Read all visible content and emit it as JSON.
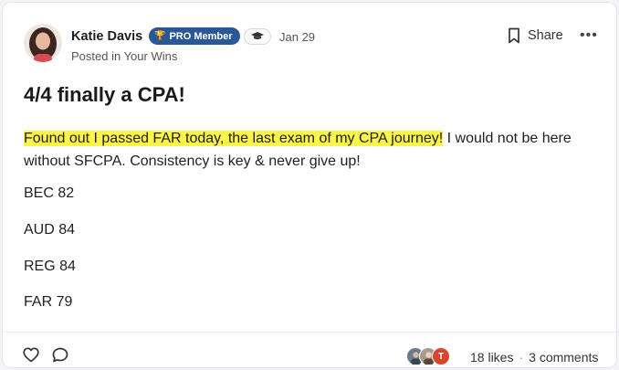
{
  "post": {
    "author": "Katie Davis",
    "badge": "PRO Member",
    "date": "Jan 29",
    "category": "Posted in Your Wins",
    "title": "4/4 finally a CPA!",
    "highlighted_text": "Found out I passed FAR today, the last exam of my CPA journey!",
    "body_rest": " I would not be here without SFCPA. Consistency is key & never give up!",
    "scores": [
      "BEC 82",
      "AUD 84",
      "REG 84",
      "FAR 79"
    ]
  },
  "actions": {
    "share_label": "Share"
  },
  "footer": {
    "likes": "18 likes",
    "separator": "·",
    "comments": "3 comments",
    "liker_initial": "T"
  },
  "colors": {
    "badge_bg": "#2b5797",
    "highlight": "#faf44b",
    "liker_t": "#d9442f"
  }
}
